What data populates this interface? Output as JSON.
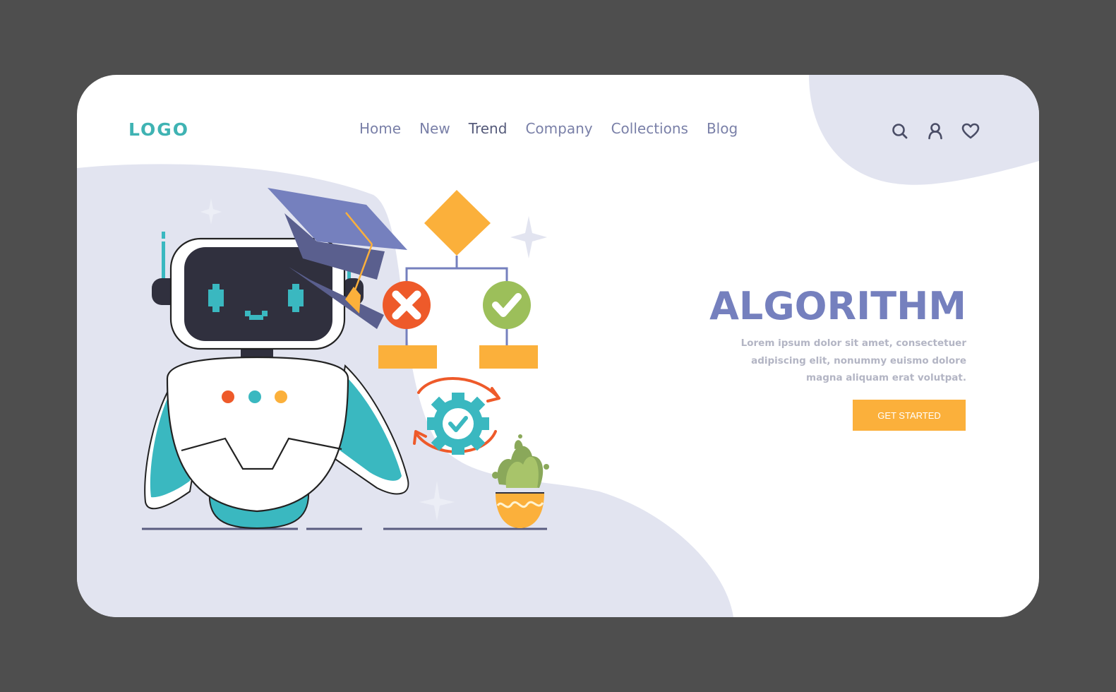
{
  "header": {
    "logo": "LOGO",
    "nav": [
      {
        "label": "Home",
        "active": false
      },
      {
        "label": "New",
        "active": false
      },
      {
        "label": "Trend",
        "active": true
      },
      {
        "label": "Company",
        "active": false
      },
      {
        "label": "Collections",
        "active": false
      },
      {
        "label": "Blog",
        "active": false
      }
    ],
    "icons": [
      "search-icon",
      "user-icon",
      "heart-icon"
    ]
  },
  "hero": {
    "title": "ALGORITHM",
    "description": "Lorem ipsum dolor sit amet, consectetuer adipiscing elit, nonummy euismo dolore magna aliquam erat volutpat.",
    "cta_label": "GET STARTED"
  },
  "colors": {
    "page_bg": "#4e4e4e",
    "card_bg": "#ffffff",
    "blob": "#e2e4f0",
    "logo": "#3fb3b3",
    "nav_text": "#7a80a8",
    "title": "#7580be",
    "body_text": "#b3b5c4",
    "cta_bg": "#fbb03b",
    "teal": "#3ab8c0",
    "dark": "#30303e",
    "orange_red": "#ee5a2a",
    "green": "#9cbf5a",
    "yellow": "#fbb03b",
    "cap": "#7580be"
  }
}
